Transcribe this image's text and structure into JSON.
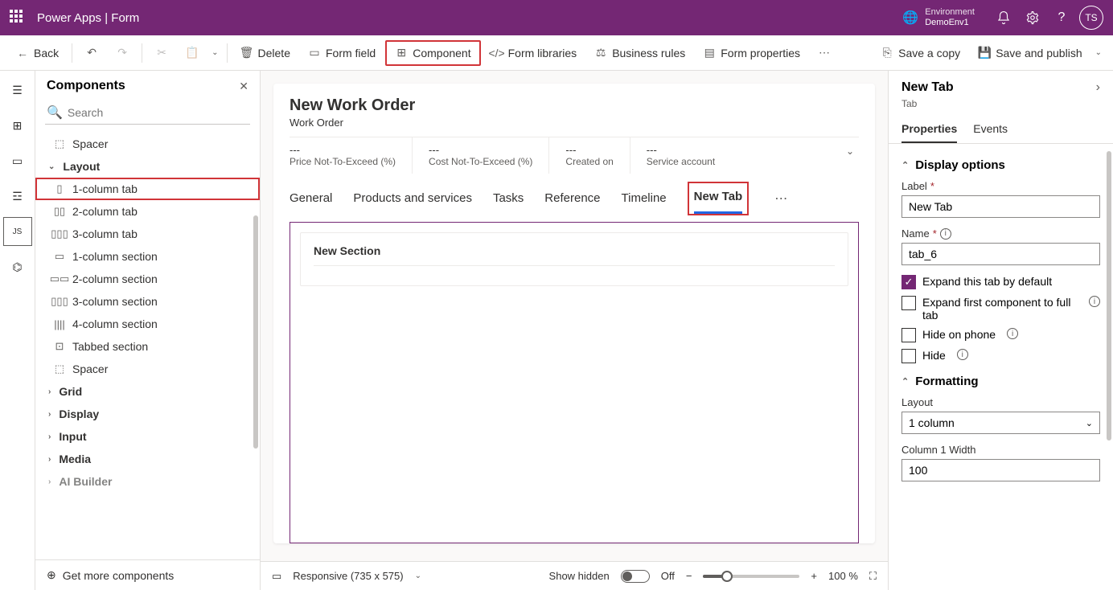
{
  "topbar": {
    "title": "Power Apps  |  Form",
    "env_label": "Environment",
    "env_name": "DemoEnv1",
    "avatar": "TS"
  },
  "cmdbar": {
    "back": "Back",
    "delete": "Delete",
    "form_field": "Form field",
    "component": "Component",
    "form_libraries": "Form libraries",
    "business_rules": "Business rules",
    "form_properties": "Form properties",
    "save_copy": "Save a copy",
    "save_publish": "Save and publish"
  },
  "panel": {
    "title": "Components",
    "search_placeholder": "Search",
    "footer": "Get more components",
    "items_top": [
      {
        "icon": "spacer",
        "label": "Spacer"
      }
    ],
    "layout_group": "Layout",
    "layout_items": [
      {
        "icon": "1col",
        "label": "1-column tab",
        "highlight": true
      },
      {
        "icon": "2col",
        "label": "2-column tab"
      },
      {
        "icon": "3col",
        "label": "3-column tab"
      },
      {
        "icon": "1sec",
        "label": "1-column section"
      },
      {
        "icon": "2sec",
        "label": "2-column section"
      },
      {
        "icon": "3sec",
        "label": "3-column section"
      },
      {
        "icon": "4sec",
        "label": "4-column section"
      },
      {
        "icon": "tabsec",
        "label": "Tabbed section"
      },
      {
        "icon": "spacer",
        "label": "Spacer"
      }
    ],
    "collapsed_groups": [
      "Grid",
      "Display",
      "Input",
      "Media",
      "AI Builder"
    ]
  },
  "form": {
    "title": "New Work Order",
    "subtitle": "Work Order",
    "header_fields": [
      {
        "value": "---",
        "label": "Price Not-To-Exceed (%)"
      },
      {
        "value": "---",
        "label": "Cost Not-To-Exceed (%)"
      },
      {
        "value": "---",
        "label": "Created on"
      },
      {
        "value": "---",
        "label": "Service account"
      }
    ],
    "tabs": [
      "General",
      "Products and services",
      "Tasks",
      "Reference",
      "Timeline",
      "New Tab"
    ],
    "active_tab": "New Tab",
    "section_title": "New Section"
  },
  "statusbar": {
    "responsive": "Responsive (735 x 575)",
    "show_hidden": "Show hidden",
    "toggle_label": "Off",
    "zoom": "100 %"
  },
  "props": {
    "title": "New Tab",
    "subtitle": "Tab",
    "tabs": [
      "Properties",
      "Events"
    ],
    "active": "Properties",
    "display_options": "Display options",
    "label_label": "Label",
    "label_value": "New Tab",
    "name_label": "Name",
    "name_value": "tab_6",
    "cb_expand_default": "Expand this tab by default",
    "cb_expand_first": "Expand first component to full tab",
    "cb_hide_phone": "Hide on phone",
    "cb_hide": "Hide",
    "formatting": "Formatting",
    "layout_label": "Layout",
    "layout_value": "1 column",
    "col1_label": "Column 1 Width",
    "col1_value": "100"
  }
}
